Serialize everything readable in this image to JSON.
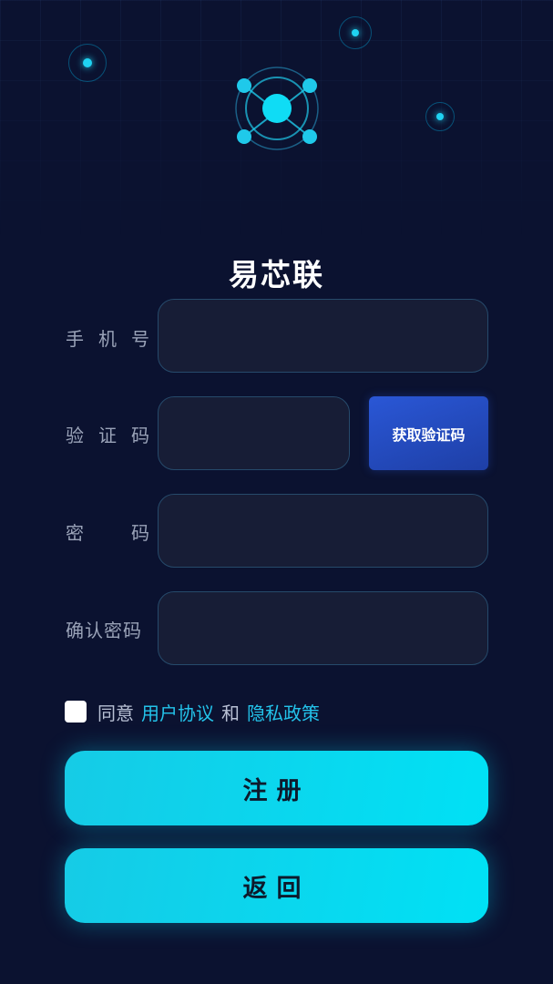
{
  "app": {
    "title": "易芯联"
  },
  "form": {
    "phone": {
      "label": [
        "手",
        "机",
        "号"
      ],
      "value": "",
      "placeholder": ""
    },
    "code": {
      "label": [
        "验",
        "证",
        "码"
      ],
      "value": "",
      "placeholder": "",
      "button_label": "获取验证码"
    },
    "password": {
      "label": [
        "密",
        "码"
      ],
      "value": "",
      "placeholder": ""
    },
    "confirm": {
      "label": [
        "确认密码"
      ],
      "value": "",
      "placeholder": ""
    }
  },
  "agreement": {
    "prefix": "同意",
    "user_agreement": "用户协议",
    "and": "和",
    "privacy_policy": "隐私政策",
    "checked": false
  },
  "buttons": {
    "register": "注册",
    "back": "返回"
  },
  "colors": {
    "background": "#0b1230",
    "accent": "#00e1f5",
    "link": "#23c3ea",
    "code_button": "#2a57d6"
  }
}
